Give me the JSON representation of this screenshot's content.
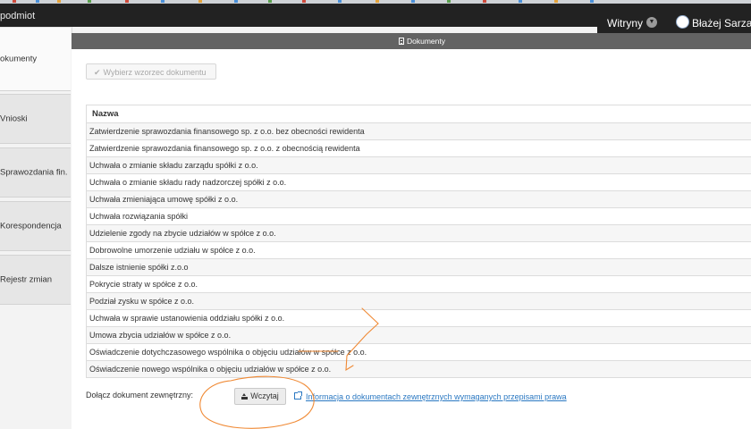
{
  "app": {
    "title": "podmiot"
  },
  "header": {
    "sites_label": "Witryny",
    "user_name": "Błażej Sarzals"
  },
  "sidebar": {
    "items": [
      {
        "label": "okumenty"
      },
      {
        "label": "Vnioski"
      },
      {
        "label": "Sprawozdania fin."
      },
      {
        "label": "Korespondencja"
      },
      {
        "label": "Rejestr zmian"
      }
    ]
  },
  "panel": {
    "title": "Dokumenty"
  },
  "toolbar": {
    "template_button": "Wybierz wzorzec dokumentu"
  },
  "table": {
    "header": "Nazwa",
    "rows": [
      "Zatwierdzenie sprawozdania finansowego sp. z o.o. bez obecności rewidenta",
      "Zatwierdzenie sprawozdania finansowego sp. z o.o. z obecnością rewidenta",
      "Uchwała o zmianie składu zarządu spółki z o.o.",
      "Uchwała o zmianie składu rady nadzorczej spółki z o.o.",
      "Uchwała zmieniająca umowę spółki z o.o.",
      "Uchwała rozwiązania spółki",
      "Udzielenie zgody na zbycie udziałów w spółce z o.o.",
      "Dobrowolne umorzenie udziału w spółce z o.o.",
      "Dalsze istnienie spółki z.o.o",
      "Pokrycie straty w spółce z o.o.",
      "Podział zysku w spółce z o.o.",
      "Uchwała w sprawie ustanowienia oddziału spółki z o.o.",
      "Umowa zbycia udziałów w spółce z o.o.",
      "Oświadczenie dotychczasowego wspólnika o objęciu udziałów w spółce z o.o.",
      "Oświadczenie nowego wspólnika o objęciu udziałów w spółce z o.o."
    ]
  },
  "footer": {
    "attach_label": "Dołącz dokument zewnętrzny:",
    "upload_button": "Wczytaj",
    "info_link": "Informacja o dokumentach zewnętrznych wymaganych przepisami prawa"
  },
  "icons": {
    "template_button": "check-icon",
    "panel_title": "document-icon",
    "upload_button": "upload-icon",
    "info_link": "external-link-icon",
    "sites_dropdown": "chevron-down-icon",
    "user": "avatar"
  },
  "colors": {
    "link": "#2a78c2",
    "topbar": "#222222",
    "panel_header": "#636363",
    "annotation": "#f08a35"
  }
}
